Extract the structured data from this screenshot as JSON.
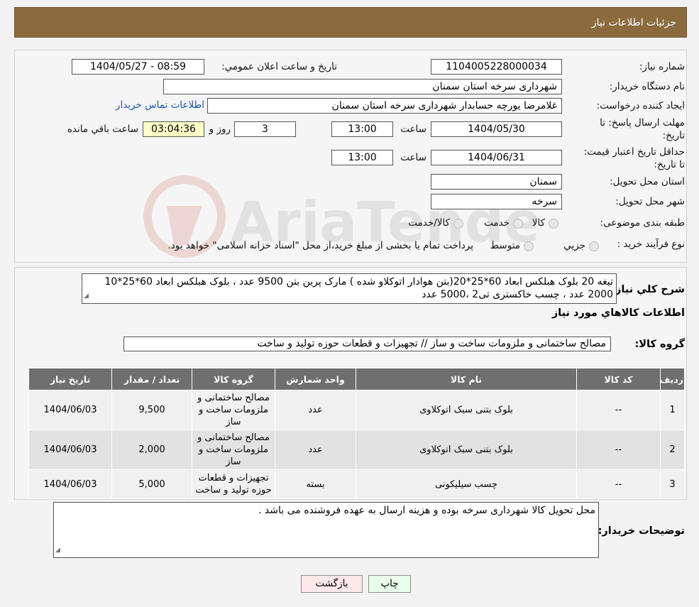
{
  "header": {
    "title": "جزئیات اطلاعات نیاز"
  },
  "form": {
    "need_number_label": "شماره نیاز:",
    "need_number": "1104005228000034",
    "announce_label": "تاریخ و ساعت اعلان عمومي:",
    "announce_value": "1404/05/27 - 08:59",
    "buyer_org_label": "نام دستگاه خریدار:",
    "buyer_org": "شهرداری سرخه استان سمنان",
    "creator_label": "ایجاد کننده درخواست:",
    "creator": "غلامرضا یورچه حسابدار شهرداری سرخه استان سمنان",
    "contact_link": "اطلاعات تماس خریدار",
    "deadline_label": "مهلت ارسال پاسخ: تا تاریخ:",
    "deadline_date": "1404/05/30",
    "time_label": "ساعت",
    "deadline_time": "13:00",
    "days_value": "3",
    "days_label": "روز و",
    "remaining_value": "03:04:36",
    "remaining_label": "ساعت باقي مانده",
    "validity_label": "حداقل تاریخ اعتبار قیمت: تا تاریخ:",
    "validity_date": "1404/06/31",
    "validity_time": "13:00",
    "province_label": "استان محل تحویل:",
    "province": "سمنان",
    "city_label": "شهر محل تحویل:",
    "city": "سرخه",
    "category_label": "طبقه بندی موضوعی:",
    "category_options": [
      "کالا",
      "خدمت",
      "کالا/خدمت"
    ],
    "process_label": "نوع فرآیند خرید :",
    "process_options": [
      "جزیي",
      "متوسط"
    ],
    "process_note": "پرداخت تمام یا بخشی از مبلغ خرید،از محل \"اسناد خزانه اسلامی\" خواهد بود."
  },
  "desc": {
    "label": "شرح كلي نياز:",
    "text": "تیغه 20 بلوک هبلکس ابعاد 60*25*20(بتن هوادار اتوکلاو شده ) مارک پرین بتن 9500 عدد ، بلوک هبلکس ابعاد 60*25*10 2000 عدد ، چسب خاکستری تی2 ،5000 عدد",
    "items_title": "اطلاعات كالاهاي مورد نياز",
    "group_label": "گروه كالا:",
    "group_value": "مصالح ساختمانی و ملزومات ساخت و ساز // تجهیزات و قطعات حوزه تولید و ساخت"
  },
  "table": {
    "headers": [
      "رديف",
      "کد کالا",
      "نام کالا",
      "واحد شمارش",
      "گروه کالا",
      "تعداد / مقدار",
      "تاریخ نیاز"
    ],
    "rows": [
      {
        "row": "1",
        "code": "--",
        "name": "بلوک بتنی سبک اتوکلاوی",
        "unit": "عدد",
        "group": "مصالح ساختمانی و ملزومات ساخت و ساز",
        "qty": "9,500",
        "date": "1404/06/03"
      },
      {
        "row": "2",
        "code": "--",
        "name": "بلوک بتنی سبک اتوکلاوی",
        "unit": "عدد",
        "group": "مصالح ساختمانی و ملزومات ساخت و ساز",
        "qty": "2,000",
        "date": "1404/06/03"
      },
      {
        "row": "3",
        "code": "--",
        "name": "چسب سیلیکونی",
        "unit": "بسته",
        "group": "تجهیزات و قطعات حوزه تولید و ساخت",
        "qty": "5,000",
        "date": "1404/06/03"
      }
    ]
  },
  "notes": {
    "label": "توضیحات خریدار:",
    "text": "محل تحویل کالا شهرداری سرخه بوده و هزینه ارسال به عهده فروشنده می باشد ."
  },
  "buttons": {
    "print": "چاپ",
    "back": "بازگشت"
  },
  "watermark": {
    "text": "AriaTender.neT"
  }
}
